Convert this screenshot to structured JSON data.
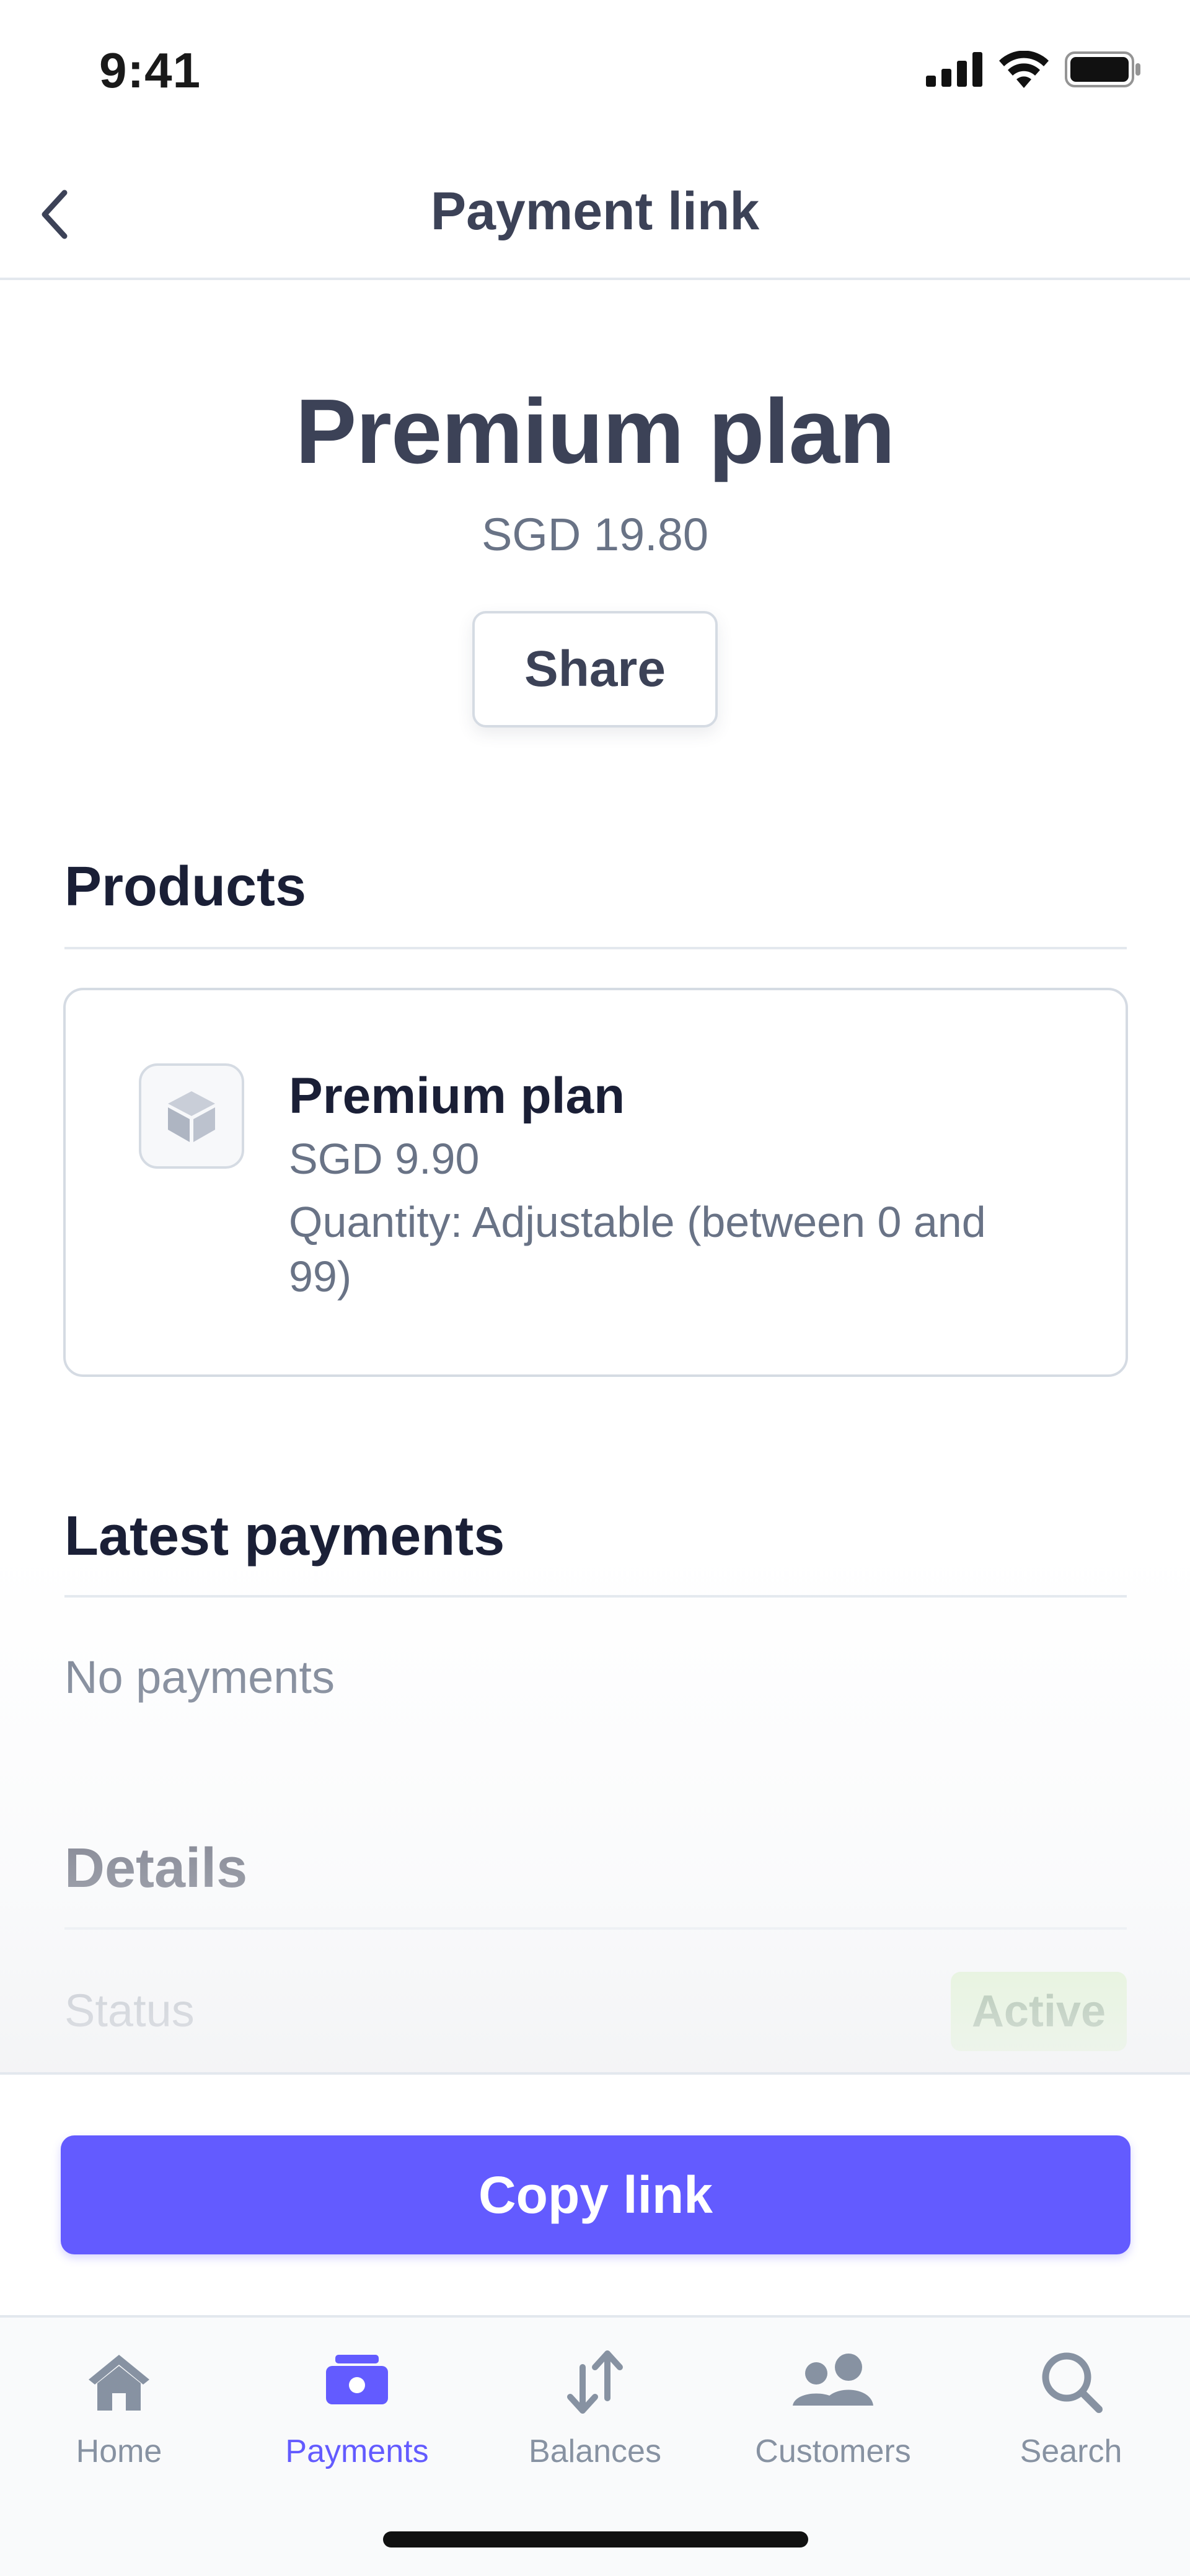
{
  "status_bar": {
    "time": "9:41"
  },
  "nav": {
    "title": "Payment link"
  },
  "hero": {
    "title": "Premium plan",
    "price": "SGD 19.80",
    "share_label": "Share"
  },
  "products": {
    "heading": "Products",
    "items": [
      {
        "name": "Premium plan",
        "price": "SGD 9.90",
        "quantity": "Quantity: Adjustable (between 0 and 99)"
      }
    ]
  },
  "payments": {
    "heading": "Latest payments",
    "empty": "No payments"
  },
  "details": {
    "heading": "Details",
    "status_label": "Status",
    "status_value": "Active"
  },
  "actions": {
    "copy_link_label": "Copy link"
  },
  "tabs": [
    {
      "label": "Home",
      "icon": "home-icon",
      "active": false
    },
    {
      "label": "Payments",
      "icon": "payments-icon",
      "active": true
    },
    {
      "label": "Balances",
      "icon": "balances-icon",
      "active": false
    },
    {
      "label": "Customers",
      "icon": "customers-icon",
      "active": false
    },
    {
      "label": "Search",
      "icon": "search-icon",
      "active": false
    }
  ],
  "colors": {
    "accent": "#635bff",
    "badge_bg": "#cbf4a9",
    "badge_text": "#1d5b15",
    "muted": "#8792a2"
  }
}
